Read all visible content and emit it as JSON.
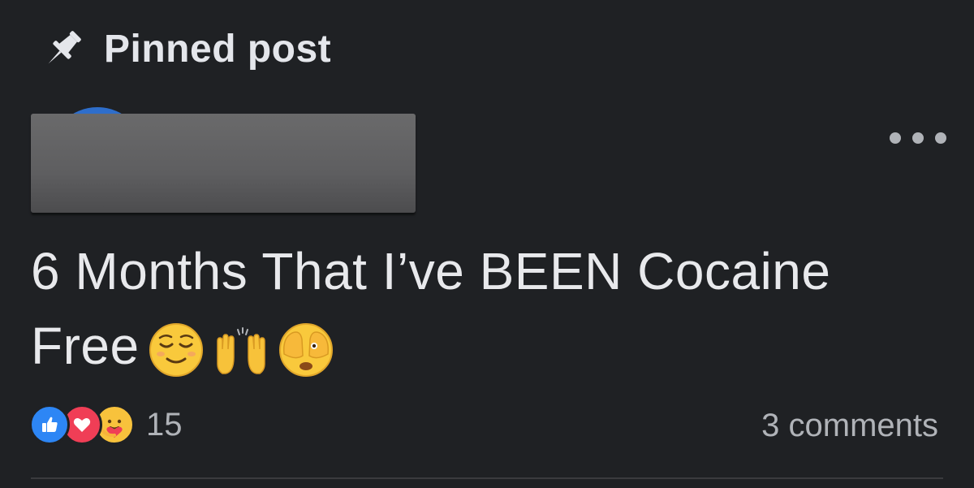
{
  "pinned": {
    "label": "Pinned post",
    "icon": "pushpin-icon"
  },
  "post": {
    "author_redacted": true,
    "text": "6 Months That I’ve BEEN Cocaine Free",
    "emojis": [
      "relieved-face-icon",
      "raising-hands-icon",
      "see-no-evil-face-icon"
    ],
    "more_icon": "ellipsis-icon"
  },
  "footer": {
    "reactions": [
      "like-icon",
      "love-icon",
      "care-icon"
    ],
    "reaction_count": "15",
    "comments_label": "3 comments"
  },
  "colors": {
    "background": "#1f2124",
    "text": "#e4e6eb",
    "secondary_text": "#b0b3b8",
    "like": "#2d86f5",
    "love": "#f03e56",
    "care": "#f8c23c"
  }
}
